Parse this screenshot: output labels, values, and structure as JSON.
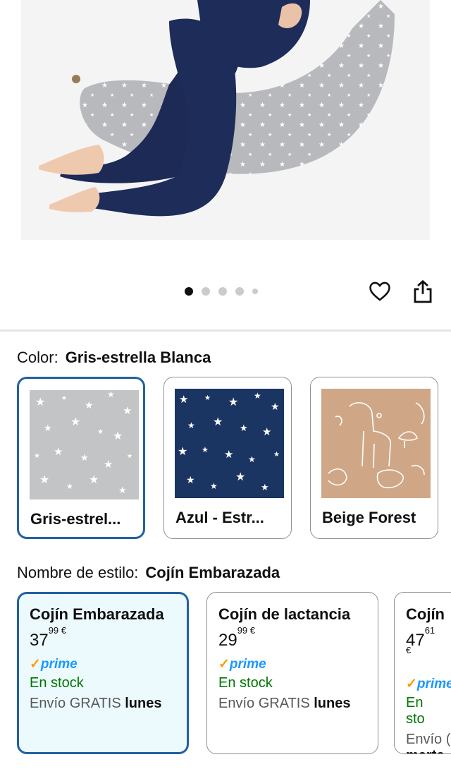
{
  "gallery": {
    "image_count": 5,
    "active_index": 0
  },
  "color": {
    "label": "Color:",
    "selected": "Gris-estrella Blanca",
    "options": [
      {
        "name": "Gris-estrel...",
        "selected": true
      },
      {
        "name": "Azul - Estr...",
        "selected": false
      },
      {
        "name": "Beige Forest",
        "selected": false
      }
    ]
  },
  "style": {
    "label": "Nombre de estilo:",
    "selected": "Cojín Embarazada",
    "options": [
      {
        "title": "Cojín Embarazada",
        "price_whole": "37",
        "price_fraction": "99",
        "currency": "€",
        "prime": "prime",
        "stock": "En stock",
        "ship_prefix": "Envío GRATIS",
        "ship_day": "lunes",
        "selected": true
      },
      {
        "title": "Cojín de lactancia",
        "price_whole": "29",
        "price_fraction": "99",
        "currency": "€",
        "prime": "prime",
        "stock": "En stock",
        "ship_prefix": "Envío GRATIS",
        "ship_day": "lunes",
        "selected": false
      },
      {
        "title": "Cojín",
        "price_whole": "47",
        "price_fraction": "61",
        "currency": "€",
        "prime": "prime",
        "stock": "En sto",
        "ship_prefix": "Envío (",
        "ship_day": "marte",
        "selected": false
      }
    ]
  },
  "colors": {
    "accent": "#2162a1",
    "selected_bg": "#edfafd",
    "stock": "#007600",
    "prime": "#1a98ff"
  }
}
